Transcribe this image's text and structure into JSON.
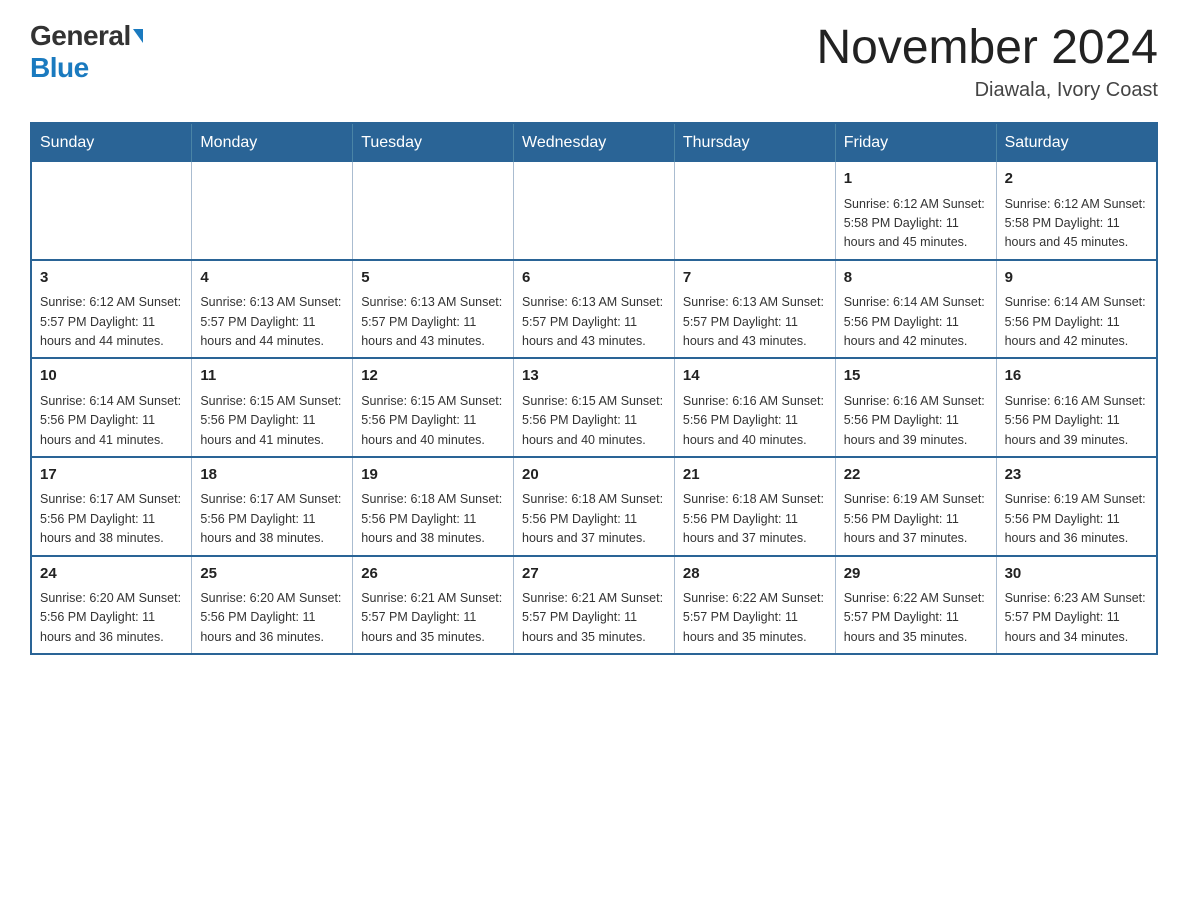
{
  "header": {
    "logo_general": "General",
    "logo_blue": "Blue",
    "month_title": "November 2024",
    "location": "Diawala, Ivory Coast"
  },
  "weekdays": [
    "Sunday",
    "Monday",
    "Tuesday",
    "Wednesday",
    "Thursday",
    "Friday",
    "Saturday"
  ],
  "weeks": [
    {
      "days": [
        {
          "num": "",
          "info": ""
        },
        {
          "num": "",
          "info": ""
        },
        {
          "num": "",
          "info": ""
        },
        {
          "num": "",
          "info": ""
        },
        {
          "num": "",
          "info": ""
        },
        {
          "num": "1",
          "info": "Sunrise: 6:12 AM\nSunset: 5:58 PM\nDaylight: 11 hours\nand 45 minutes."
        },
        {
          "num": "2",
          "info": "Sunrise: 6:12 AM\nSunset: 5:58 PM\nDaylight: 11 hours\nand 45 minutes."
        }
      ]
    },
    {
      "days": [
        {
          "num": "3",
          "info": "Sunrise: 6:12 AM\nSunset: 5:57 PM\nDaylight: 11 hours\nand 44 minutes."
        },
        {
          "num": "4",
          "info": "Sunrise: 6:13 AM\nSunset: 5:57 PM\nDaylight: 11 hours\nand 44 minutes."
        },
        {
          "num": "5",
          "info": "Sunrise: 6:13 AM\nSunset: 5:57 PM\nDaylight: 11 hours\nand 43 minutes."
        },
        {
          "num": "6",
          "info": "Sunrise: 6:13 AM\nSunset: 5:57 PM\nDaylight: 11 hours\nand 43 minutes."
        },
        {
          "num": "7",
          "info": "Sunrise: 6:13 AM\nSunset: 5:57 PM\nDaylight: 11 hours\nand 43 minutes."
        },
        {
          "num": "8",
          "info": "Sunrise: 6:14 AM\nSunset: 5:56 PM\nDaylight: 11 hours\nand 42 minutes."
        },
        {
          "num": "9",
          "info": "Sunrise: 6:14 AM\nSunset: 5:56 PM\nDaylight: 11 hours\nand 42 minutes."
        }
      ]
    },
    {
      "days": [
        {
          "num": "10",
          "info": "Sunrise: 6:14 AM\nSunset: 5:56 PM\nDaylight: 11 hours\nand 41 minutes."
        },
        {
          "num": "11",
          "info": "Sunrise: 6:15 AM\nSunset: 5:56 PM\nDaylight: 11 hours\nand 41 minutes."
        },
        {
          "num": "12",
          "info": "Sunrise: 6:15 AM\nSunset: 5:56 PM\nDaylight: 11 hours\nand 40 minutes."
        },
        {
          "num": "13",
          "info": "Sunrise: 6:15 AM\nSunset: 5:56 PM\nDaylight: 11 hours\nand 40 minutes."
        },
        {
          "num": "14",
          "info": "Sunrise: 6:16 AM\nSunset: 5:56 PM\nDaylight: 11 hours\nand 40 minutes."
        },
        {
          "num": "15",
          "info": "Sunrise: 6:16 AM\nSunset: 5:56 PM\nDaylight: 11 hours\nand 39 minutes."
        },
        {
          "num": "16",
          "info": "Sunrise: 6:16 AM\nSunset: 5:56 PM\nDaylight: 11 hours\nand 39 minutes."
        }
      ]
    },
    {
      "days": [
        {
          "num": "17",
          "info": "Sunrise: 6:17 AM\nSunset: 5:56 PM\nDaylight: 11 hours\nand 38 minutes."
        },
        {
          "num": "18",
          "info": "Sunrise: 6:17 AM\nSunset: 5:56 PM\nDaylight: 11 hours\nand 38 minutes."
        },
        {
          "num": "19",
          "info": "Sunrise: 6:18 AM\nSunset: 5:56 PM\nDaylight: 11 hours\nand 38 minutes."
        },
        {
          "num": "20",
          "info": "Sunrise: 6:18 AM\nSunset: 5:56 PM\nDaylight: 11 hours\nand 37 minutes."
        },
        {
          "num": "21",
          "info": "Sunrise: 6:18 AM\nSunset: 5:56 PM\nDaylight: 11 hours\nand 37 minutes."
        },
        {
          "num": "22",
          "info": "Sunrise: 6:19 AM\nSunset: 5:56 PM\nDaylight: 11 hours\nand 37 minutes."
        },
        {
          "num": "23",
          "info": "Sunrise: 6:19 AM\nSunset: 5:56 PM\nDaylight: 11 hours\nand 36 minutes."
        }
      ]
    },
    {
      "days": [
        {
          "num": "24",
          "info": "Sunrise: 6:20 AM\nSunset: 5:56 PM\nDaylight: 11 hours\nand 36 minutes."
        },
        {
          "num": "25",
          "info": "Sunrise: 6:20 AM\nSunset: 5:56 PM\nDaylight: 11 hours\nand 36 minutes."
        },
        {
          "num": "26",
          "info": "Sunrise: 6:21 AM\nSunset: 5:57 PM\nDaylight: 11 hours\nand 35 minutes."
        },
        {
          "num": "27",
          "info": "Sunrise: 6:21 AM\nSunset: 5:57 PM\nDaylight: 11 hours\nand 35 minutes."
        },
        {
          "num": "28",
          "info": "Sunrise: 6:22 AM\nSunset: 5:57 PM\nDaylight: 11 hours\nand 35 minutes."
        },
        {
          "num": "29",
          "info": "Sunrise: 6:22 AM\nSunset: 5:57 PM\nDaylight: 11 hours\nand 35 minutes."
        },
        {
          "num": "30",
          "info": "Sunrise: 6:23 AM\nSunset: 5:57 PM\nDaylight: 11 hours\nand 34 minutes."
        }
      ]
    }
  ]
}
